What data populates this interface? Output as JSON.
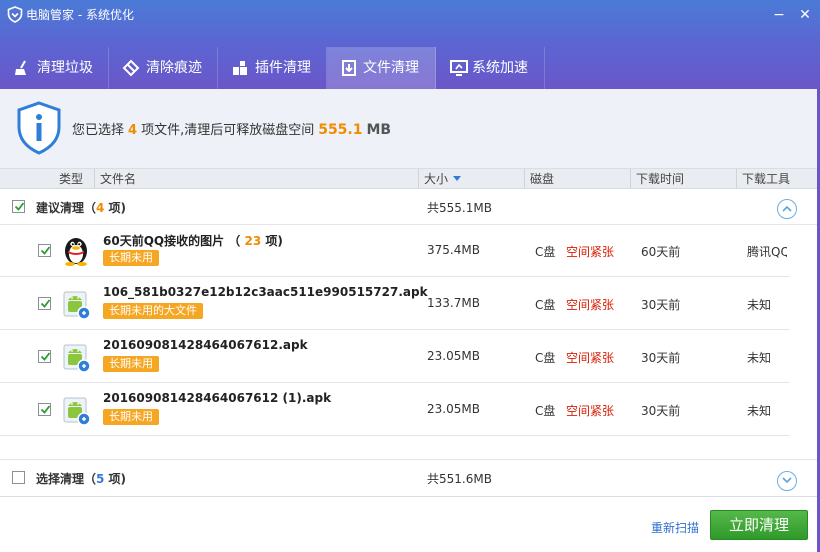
{
  "window": {
    "title": "电脑管家 - 系统优化",
    "minimize_glyph": "−",
    "close_glyph": "✕"
  },
  "tabs": [
    {
      "label": "清理垃圾",
      "icon": "broom-icon",
      "active": false
    },
    {
      "label": "清除痕迹",
      "icon": "eraser-icon",
      "active": false
    },
    {
      "label": "插件清理",
      "icon": "plugin-icon",
      "active": false
    },
    {
      "label": "文件清理",
      "icon": "file-clean-icon",
      "active": true
    },
    {
      "label": "系统加速",
      "icon": "monitor-speed-icon",
      "active": false
    }
  ],
  "summary": {
    "prefix": "您已选择",
    "count": "4",
    "middle": "项文件,清理后可释放磁盘空间",
    "size": "555.1",
    "unit": "MB"
  },
  "table_header": {
    "type": "类型",
    "name": "文件名",
    "size": "大小",
    "disk": "磁盘",
    "time": "下载时间",
    "tool": "下载工具"
  },
  "groups": [
    {
      "title_prefix": "建议清理（",
      "count": "4",
      "title_suffix": " 项)",
      "total": "共555.1MB",
      "checked": true,
      "expanded": true
    },
    {
      "title_prefix": "选择清理（",
      "count": "5",
      "title_suffix": " 项)",
      "total": "共551.6MB",
      "checked": false,
      "expanded": false
    }
  ],
  "rows": [
    {
      "name_prefix": "60天前QQ接收的图片 （ ",
      "name_count": "23",
      "name_suffix": " 项)",
      "tag": "长期未用",
      "size": "375.4MB",
      "disk": "C盘",
      "status": "空间紧张",
      "time": "60天前",
      "tool": "腾讯QQ",
      "icon": "qq-penguin-icon",
      "checked": true
    },
    {
      "name_prefix": "106_581b0327e12b12c3aac511e990515727.apk",
      "name_count": "",
      "name_suffix": "",
      "tag": "长期未用的大文件",
      "size": "133.7MB",
      "disk": "C盘",
      "status": "空间紧张",
      "time": "30天前",
      "tool": "未知",
      "icon": "android-apk-icon",
      "checked": true
    },
    {
      "name_prefix": "20160908142846406761​2.apk",
      "name_count": "",
      "name_suffix": "",
      "tag": "长期未用",
      "size": "23.05MB",
      "disk": "C盘",
      "status": "空间紧张",
      "time": "30天前",
      "tool": "未知",
      "icon": "android-apk-icon",
      "checked": true
    },
    {
      "name_prefix": "201609081428464067612 (1).apk",
      "name_count": "",
      "name_suffix": "",
      "tag": "长期未用",
      "size": "23.05MB",
      "disk": "C盘",
      "status": "空间紧张",
      "time": "30天前",
      "tool": "未知",
      "icon": "android-apk-icon",
      "checked": true
    }
  ],
  "footer": {
    "rescan": "重新扫描",
    "clean_now": "立即清理"
  },
  "colors": {
    "accent_orange": "#f08c00",
    "warning_red": "#d81e06",
    "link_blue": "#2f6fcf",
    "button_green": "#3aa533"
  }
}
